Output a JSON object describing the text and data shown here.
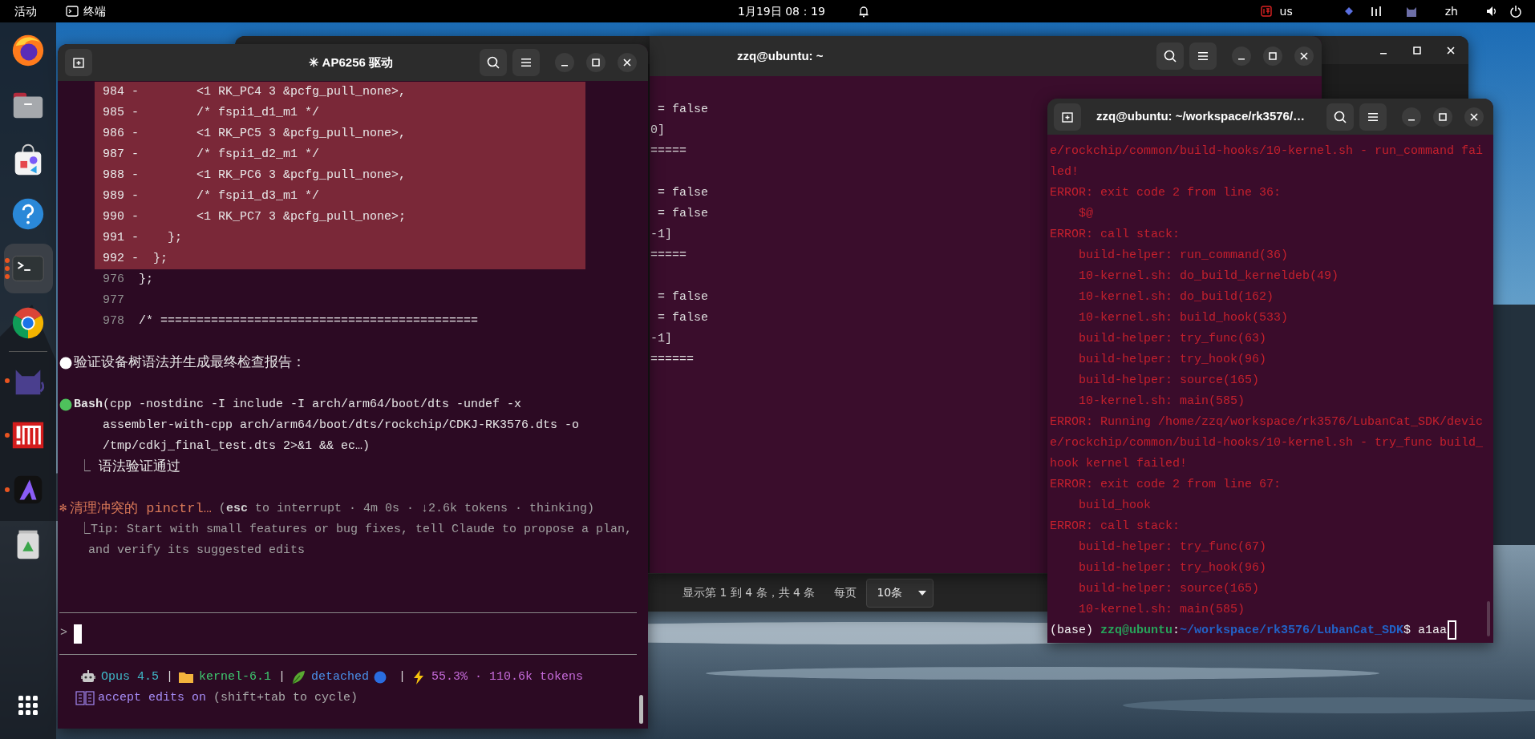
{
  "top_bar": {
    "activities": "活动",
    "app_name": "终端",
    "clock": "1月19日 08：19",
    "keyboard_layout": "us",
    "language": "zh"
  },
  "dock": {
    "items": [
      {
        "kind": "firefox",
        "running": false,
        "selected": false
      },
      {
        "kind": "files",
        "running": false,
        "selected": false
      },
      {
        "kind": "app-center",
        "running": false,
        "selected": false
      },
      {
        "kind": "help",
        "running": false,
        "selected": false
      },
      {
        "kind": "terminal",
        "running": true,
        "multiple_windows": true,
        "selected": true
      },
      {
        "kind": "chrome",
        "running": false,
        "selected": false
      },
      {
        "kind": "separator"
      },
      {
        "kind": "cat",
        "running": true,
        "multiple_windows": false,
        "selected": false
      },
      {
        "kind": "red-app",
        "running": true,
        "multiple_windows": false,
        "selected": false
      },
      {
        "kind": "a-app",
        "running": true,
        "multiple_windows": false,
        "selected": false
      },
      {
        "kind": "trash",
        "running": false,
        "selected": false
      }
    ]
  },
  "browser_window": {
    "pagination": {
      "summary": "显示第 1 到 4 条，共 4 条",
      "per_page_label": "每页",
      "page_size": "10条"
    }
  },
  "shell_terminal_home": {
    "title": "zzq@ubuntu: ~",
    "blocks": [
      [
        " = false",
        "0]",
        "====="
      ],
      [
        " = false",
        " = false",
        "-1]",
        "====="
      ],
      [
        " = false",
        " = false",
        "-1]",
        "======"
      ]
    ]
  },
  "claude_terminal": {
    "title": "✳ AP6256 驱动",
    "code_lines": [
      {
        "number": "984",
        "text": "-        <1 RK_PC4 3 &pcfg_pull_none>,",
        "removed": true
      },
      {
        "number": "985",
        "text": "-        /* fspi1_d1_m1 */",
        "removed": true
      },
      {
        "number": "986",
        "text": "-        <1 RK_PC5 3 &pcfg_pull_none>,",
        "removed": true
      },
      {
        "number": "987",
        "text": "-        /* fspi1_d2_m1 */",
        "removed": true
      },
      {
        "number": "988",
        "text": "-        <1 RK_PC6 3 &pcfg_pull_none>,",
        "removed": true
      },
      {
        "number": "989",
        "text": "-        /* fspi1_d3_m1 */",
        "removed": true
      },
      {
        "number": "990",
        "text": "-        <1 RK_PC7 3 &pcfg_pull_none>;",
        "removed": true
      },
      {
        "number": "991",
        "text": "-    };",
        "removed": true
      },
      {
        "number": "992",
        "text": "-  };",
        "removed": true
      },
      {
        "number": "976",
        "text": " };",
        "removed": false
      },
      {
        "number": "977",
        "removed": false
      },
      {
        "number": "978",
        "text": " /* ============================================",
        "removed": false
      }
    ],
    "events": [
      {
        "kind": "message",
        "color": "#ffffff",
        "lines": [
          "验证设备树语法并生成最终检查报告："
        ]
      },
      {
        "kind": "tool",
        "color": "#4ec25c",
        "lines": [
          "**Bash**(cpp -nostdinc -I include -I arch/arm64/boot/dts -undef -x",
          "assembler-with-cpp arch/arm64/boot/dts/rockchip/CDKJ-RK3576.dts -o",
          "/tmp/cdkj_final_test.dts 2>&1 && ec…)"
        ],
        "result_mark": "⎿",
        "result": "语法验证通过"
      }
    ],
    "activity": {
      "spinner": "✻",
      "task": "清理冲突的 pinctrl…",
      "detail": "(**esc** to interrupt · 4m 0s · ↓2.6k tokens · thinking)",
      "tip_mark": "⎿",
      "tip_lines": [
        "Tip: Start with small features or bug fixes, tell Claude to propose a plan,",
        "and verify its suggested edits"
      ]
    },
    "prompt": {
      "symbol": ">"
    },
    "status": [
      {
        "kind": "model",
        "text": "Opus 4.5"
      },
      {
        "kind": "divider",
        "text": "|"
      },
      {
        "kind": "folder",
        "text": "kernel-6.1"
      },
      {
        "kind": "divider",
        "text": "|"
      },
      {
        "kind": "branch",
        "text": "detached"
      },
      {
        "kind": "divider",
        "text": "|"
      },
      {
        "kind": "usage",
        "text": "55.3% · 110.6k tokens"
      }
    ],
    "mode": {
      "text": "accept edits on",
      "hint": "(shift+tab to cycle)"
    }
  },
  "build_terminal": {
    "title": "zzq@ubuntu: ~/workspace/rk3576/…",
    "lines": [
      "e/rockchip/common/build-hooks/10-kernel.sh - run_command fai",
      "led!",
      "ERROR: exit code 2 from line 36:",
      "    $@",
      "ERROR: call stack:",
      "    build-helper: run_command(36)",
      "    10-kernel.sh: do_build_kerneldeb(49)",
      "    10-kernel.sh: do_build(162)",
      "    10-kernel.sh: build_hook(533)",
      "    build-helper: try_func(63)",
      "    build-helper: try_hook(96)",
      "    build-helper: source(165)",
      "    10-kernel.sh: main(585)",
      "ERROR: Running /home/zzq/workspace/rk3576/LubanCat_SDK/devic",
      "e/rockchip/common/build-hooks/10-kernel.sh - try_func build_",
      "hook kernel failed!",
      "ERROR: exit code 2 from line 67:",
      "    build_hook",
      "ERROR: call stack:",
      "    build-helper: try_func(67)",
      "    build-helper: try_hook(96)",
      "    build-helper: source(165)",
      "    10-kernel.sh: main(585)"
    ],
    "prompt": {
      "env": "(base)",
      "user_host": "zzq@ubuntu",
      "separator": ":",
      "path": "~/workspace/rk3576/LubanCat_SDK",
      "symbol": "$",
      "input": "a1aa"
    }
  }
}
